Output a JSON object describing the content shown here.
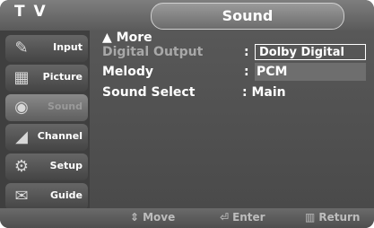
{
  "header": {
    "tv_label": "T V",
    "title": "Sound"
  },
  "sidebar": {
    "items": [
      {
        "label": "Input",
        "icon": "input-icon",
        "glyph": "✎",
        "active": false
      },
      {
        "label": "Picture",
        "icon": "picture-icon",
        "glyph": "▦",
        "active": false
      },
      {
        "label": "Sound",
        "icon": "sound-icon",
        "glyph": "◉",
        "active": true
      },
      {
        "label": "Channel",
        "icon": "channel-icon",
        "glyph": "◢",
        "active": false
      },
      {
        "label": "Setup",
        "icon": "setup-icon",
        "glyph": "⚙",
        "active": false
      },
      {
        "label": "Guide",
        "icon": "guide-icon",
        "glyph": "✉",
        "active": false
      }
    ]
  },
  "menu": {
    "more": "▲ More",
    "digital_output": {
      "label": "Digital Output",
      "value": "Dolby Digital"
    },
    "melody": {
      "label": "Melody",
      "value": "PCM"
    },
    "sound_select": {
      "label": "Sound Select",
      "value": "Main"
    }
  },
  "footer": {
    "move": "Move",
    "enter": "Enter",
    "return": "Return"
  }
}
